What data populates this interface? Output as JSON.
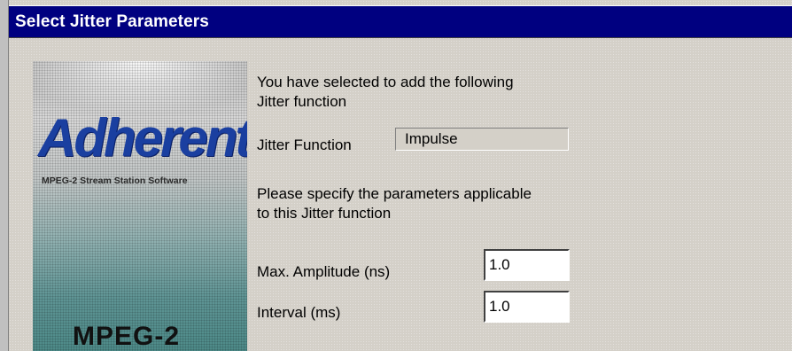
{
  "dialog": {
    "title": "Select Jitter Parameters",
    "intro_line1": "You have selected to add the following",
    "intro_line2": "Jitter function",
    "jitter_function_label": "Jitter Function",
    "jitter_function_value": "Impulse",
    "specify_line1": "Please specify the parameters applicable",
    "specify_line2": "to this Jitter function",
    "max_amplitude_label": "Max. Amplitude (ns)",
    "max_amplitude_value": "1.0",
    "interval_label": "Interval (ms)",
    "interval_value": "1.0"
  },
  "banner": {
    "logo_text": "Adherent",
    "subtitle": "MPEG-2 Stream Station Software",
    "product": "MPEG-2"
  },
  "colors": {
    "titlebar": "#000080",
    "dialog_bg": "#d4d0c8",
    "logo_blue": "#1a3fa0"
  }
}
